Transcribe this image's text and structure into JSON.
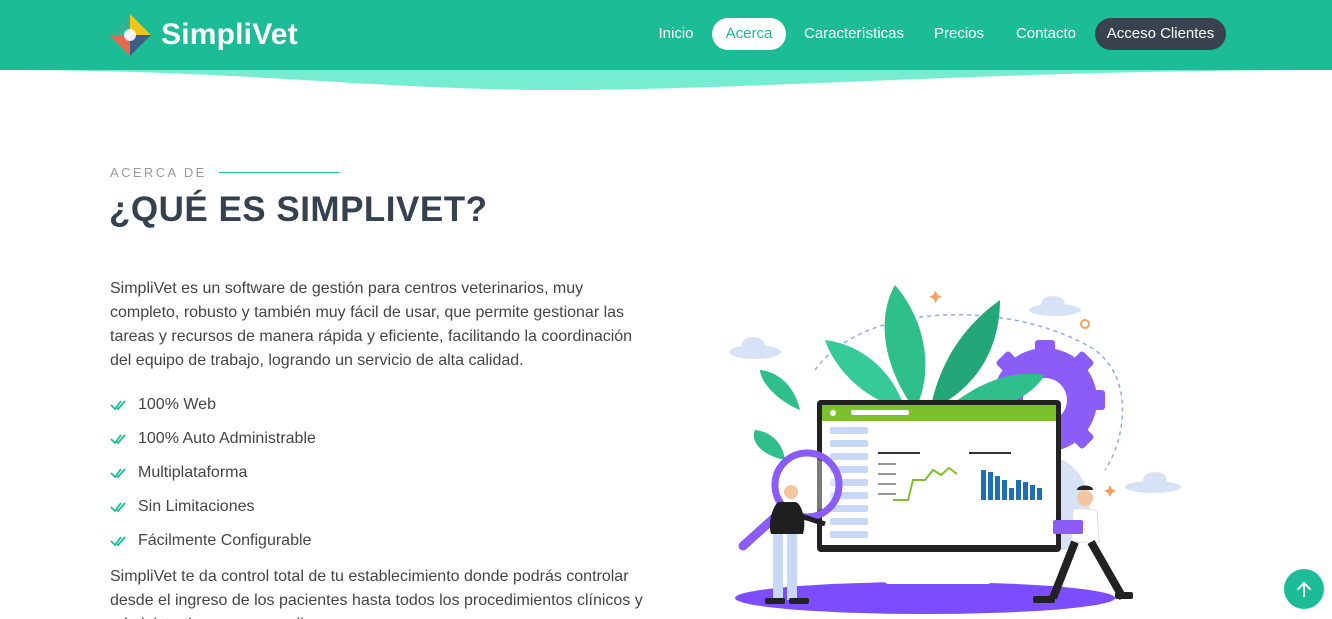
{
  "brand": {
    "name": "SimpliVet",
    "logo_icon": "simplivet-logo-icon"
  },
  "nav": {
    "items": [
      {
        "label": "Inicio",
        "active": false
      },
      {
        "label": "Acerca",
        "active": true
      },
      {
        "label": "Características",
        "active": false
      },
      {
        "label": "Precios",
        "active": false
      },
      {
        "label": "Contacto",
        "active": false
      }
    ],
    "client_button": "Acceso Clientes"
  },
  "about": {
    "eyebrow": "ACERCA DE",
    "title": "¿QUÉ ES SIMPLIVET?",
    "intro": "SimpliVet es un software de gestión para centros veterinarios, muy completo, robusto y también muy fácil de usar, que permite gestionar las tareas y recursos de manera rápida y eficiente, facilitando la coordinación del equipo de trabajo, logrando un servicio de alta calidad.",
    "features": [
      "100% Web",
      "100% Auto Administrable",
      "Multiplataforma",
      "Sin Limitaciones",
      "Fácilmente Configurable"
    ],
    "paragraph2": "SimpliVet te da control total de tu establecimiento donde podrás controlar desde el ingreso de los pacientes hasta todos los procedimientos clínicos y administrativos que se realicen."
  },
  "colors": {
    "primary": "#1cbc97",
    "header_light": "#76ecd1",
    "dark_button": "#38434f",
    "title": "#35414e"
  },
  "icons": {
    "check": "double-check-icon",
    "scroll_top": "arrow-up-icon"
  }
}
